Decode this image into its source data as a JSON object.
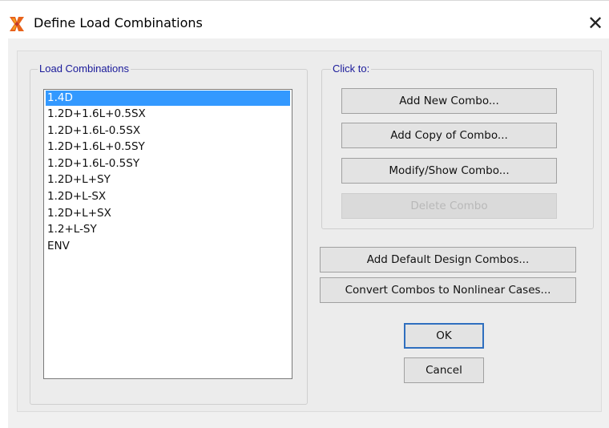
{
  "window": {
    "title": "Define Load Combinations",
    "app_icon": "etabs-app-icon",
    "close_glyph": "✕"
  },
  "load_combinations_group": {
    "label": "Load Combinations",
    "items": [
      {
        "label": "1.4D",
        "selected": true
      },
      {
        "label": "1.2D+1.6L+0.5SX",
        "selected": false
      },
      {
        "label": "1.2D+1.6L-0.5SX",
        "selected": false
      },
      {
        "label": "1.2D+1.6L+0.5SY",
        "selected": false
      },
      {
        "label": "1.2D+1.6L-0.5SY",
        "selected": false
      },
      {
        "label": "1.2D+L+SY",
        "selected": false
      },
      {
        "label": "1.2D+L-SX",
        "selected": false
      },
      {
        "label": "1.2D+L+SX",
        "selected": false
      },
      {
        "label": "1.2+L-SY",
        "selected": false
      },
      {
        "label": "ENV",
        "selected": false
      }
    ]
  },
  "click_to_group": {
    "label": "Click to:",
    "add_new_combo": "Add New Combo...",
    "add_copy_of_combo": "Add Copy of Combo...",
    "modify_show_combo": "Modify/Show Combo...",
    "delete_combo": "Delete Combo"
  },
  "actions": {
    "add_default_design_combos": "Add Default Design Combos...",
    "convert_combos": "Convert Combos to Nonlinear Cases..."
  },
  "dialog_buttons": {
    "ok": "OK",
    "cancel": "Cancel"
  },
  "colors": {
    "selection": "#3399ff",
    "group_label": "#1a1a9a",
    "dialog_bg": "#f0f0f0"
  }
}
